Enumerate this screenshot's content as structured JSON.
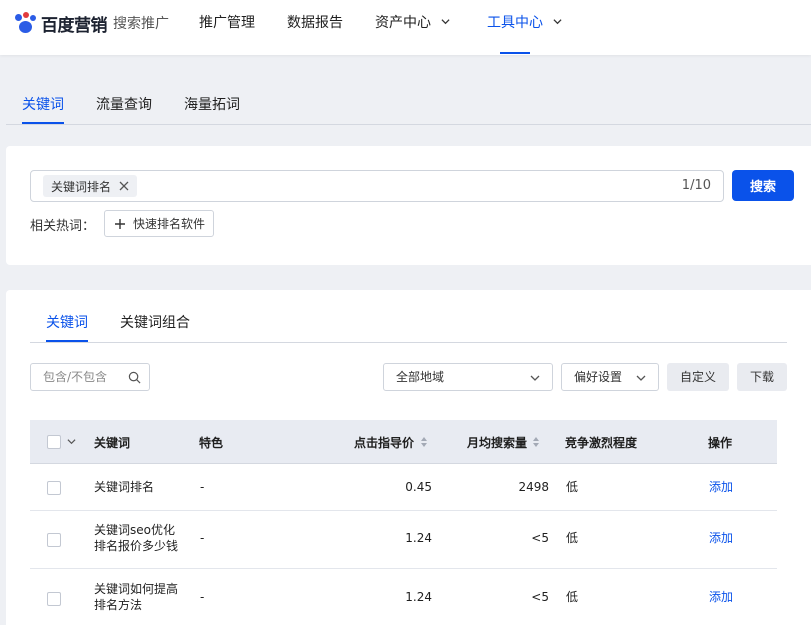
{
  "brand": {
    "name": "百度营销",
    "product": "搜索推广"
  },
  "nav": [
    {
      "label": "推广管理",
      "active": false
    },
    {
      "label": "数据报告",
      "active": false
    },
    {
      "label": "资产中心",
      "active": false,
      "dropdown": true
    },
    {
      "label": "工具中心",
      "active": true,
      "dropdown": true
    }
  ],
  "page_tabs": [
    {
      "label": "关键词",
      "active": true
    },
    {
      "label": "流量查询",
      "active": false
    },
    {
      "label": "海量拓词",
      "active": false
    }
  ],
  "search": {
    "tag": "关键词排名",
    "counter": "1/10",
    "button": "搜索",
    "hot_label": "相关热词：",
    "hot_chip": "快速排名软件"
  },
  "result_tabs": [
    {
      "label": "关键词",
      "active": true
    },
    {
      "label": "关键词组合",
      "active": false
    }
  ],
  "filters": {
    "include_placeholder": "包含/不包含",
    "region": "全部地域",
    "preference": "偏好设置",
    "customize": "自定义",
    "download": "下载"
  },
  "table": {
    "columns": [
      "关键词",
      "特色",
      "点击指导价",
      "月均搜索量",
      "竞争激烈程度",
      "操作"
    ],
    "rows": [
      {
        "keyword": [
          "关键词排名"
        ],
        "feature": "-",
        "price": "0.45",
        "volume": "2498",
        "competition": "低",
        "action": "添加"
      },
      {
        "keyword": [
          "关键词seo优化",
          "排名报价多少钱"
        ],
        "feature": "-",
        "price": "1.24",
        "volume": "<5",
        "competition": "低",
        "action": "添加"
      },
      {
        "keyword": [
          "关键词如何提高",
          "排名方法"
        ],
        "feature": "-",
        "price": "1.24",
        "volume": "<5",
        "competition": "低",
        "action": "添加"
      }
    ]
  },
  "colors": {
    "accent": "#0a52ea",
    "page_bg": "#eef0f4",
    "header_bg": "#e8ebf2"
  }
}
